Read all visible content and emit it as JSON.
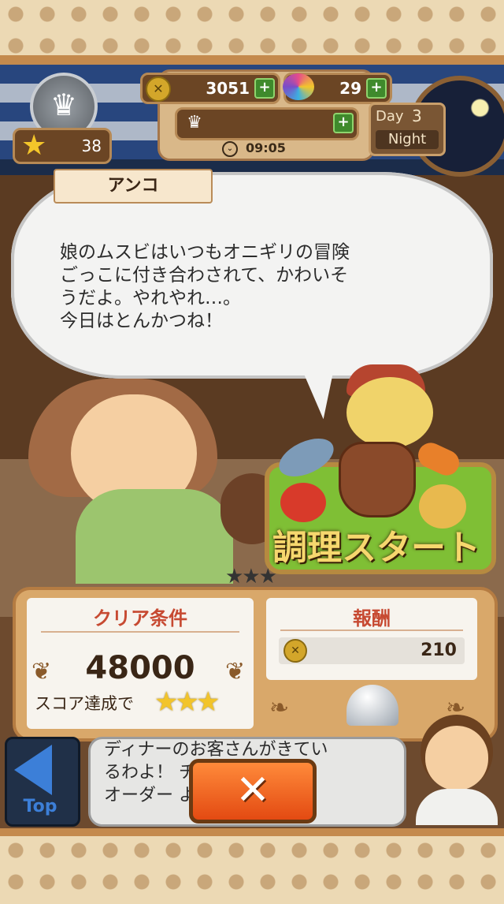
{
  "hud": {
    "level_icon": "chef-hat-icon",
    "star_count": "38",
    "coins": "3051",
    "candy": "29",
    "time": "09:05",
    "day_label": "Day",
    "day_number": "3",
    "phase": "Night"
  },
  "dialog": {
    "speaker": "アンコ",
    "text": "娘のムスビはいつもオニギリの冒険\nごっこに付き合わされて、かわいそ\nうだよ。やれやれ…。\n今日はとんかつね！"
  },
  "cook_start": {
    "label": "調理スタート"
  },
  "clear": {
    "title": "クリア条件",
    "score": "48000",
    "note": "スコア達成で",
    "stars": "★★★"
  },
  "reward": {
    "title": "報酬",
    "value": "210"
  },
  "bottom": {
    "back_label": "Top",
    "hint": "ディナーのお客さんがきてい\nるわよ！                    チして\nオーダー                  よう！",
    "close_symbol": "✕"
  },
  "colors": {
    "accent_red": "#c74a32",
    "button_orange": "#e34a12",
    "cook_green": "#7fbf35"
  }
}
